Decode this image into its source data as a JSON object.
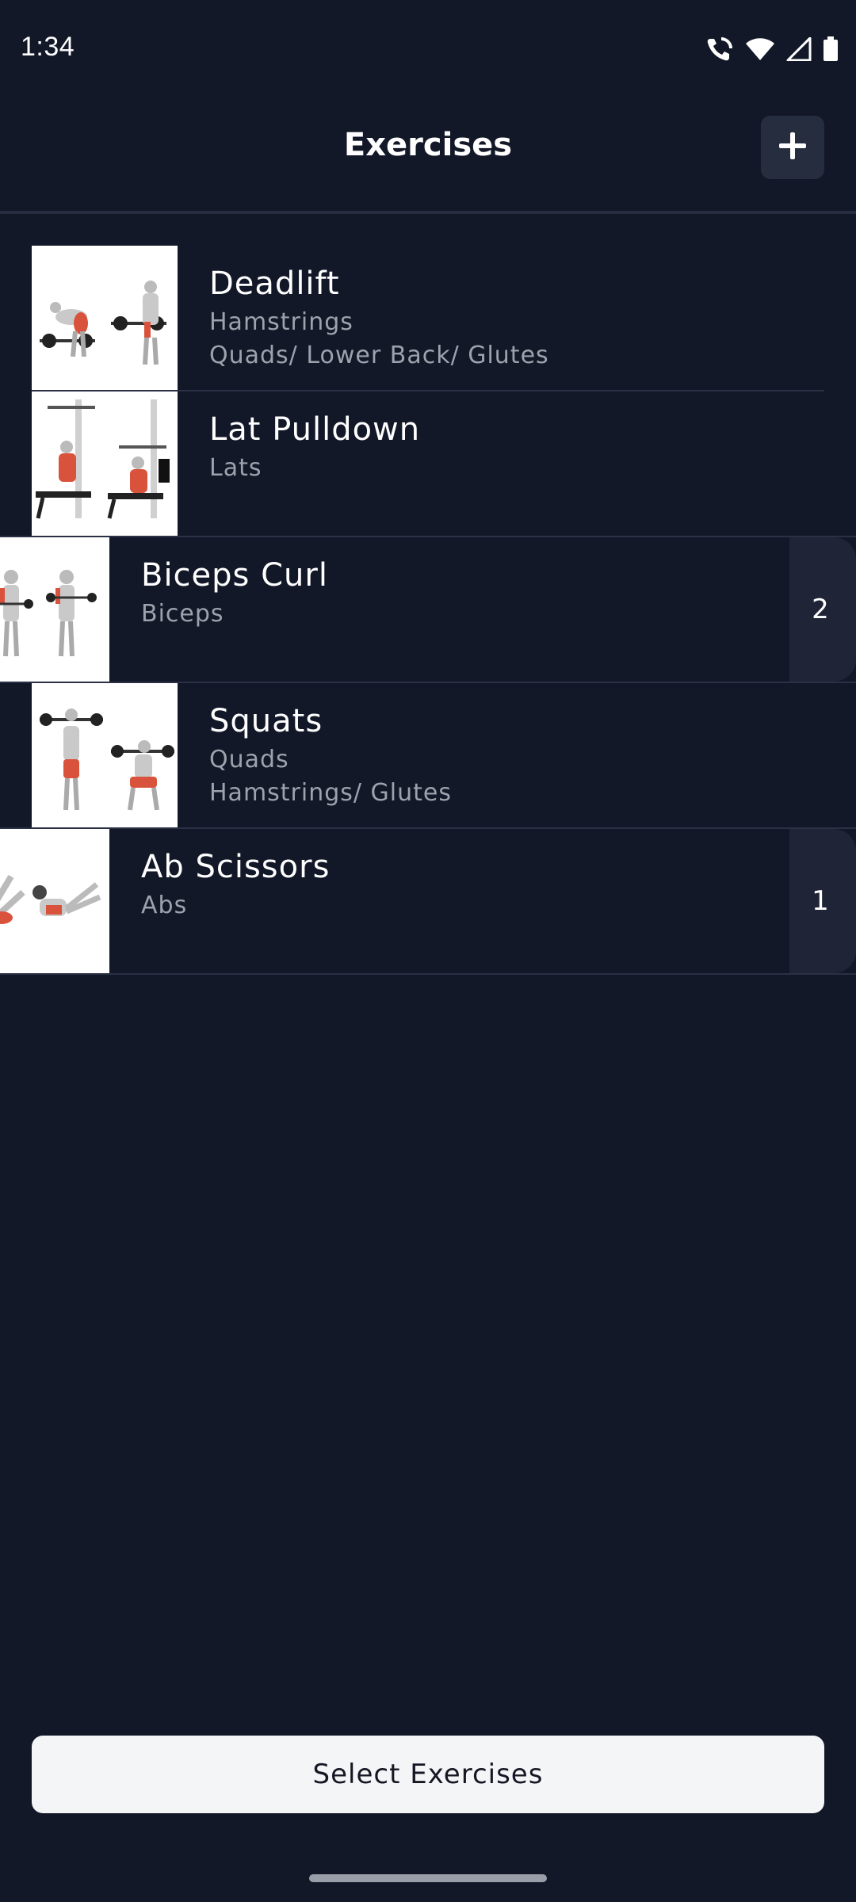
{
  "status_bar": {
    "time": "1:34",
    "icons": [
      "wifi-calling-icon",
      "wifi-icon",
      "signal-icon",
      "battery-icon"
    ]
  },
  "header": {
    "title": "Exercises",
    "add_icon": "plus-icon"
  },
  "exercises": [
    {
      "name": "Deadlift",
      "primary": "Hamstrings",
      "secondary": "Quads/ Lower Back/ Glutes",
      "swiped": false,
      "action_label": ""
    },
    {
      "name": "Lat Pulldown",
      "primary": "Lats",
      "secondary": "",
      "swiped": false,
      "action_label": ""
    },
    {
      "name": "Biceps Curl",
      "primary": "Biceps",
      "secondary": "",
      "swiped": true,
      "action_label": "2"
    },
    {
      "name": "Squats",
      "primary": "Quads",
      "secondary": "Hamstrings/ Glutes",
      "swiped": false,
      "action_label": ""
    },
    {
      "name": "Ab Scissors",
      "primary": "Abs",
      "secondary": "",
      "swiped": true,
      "action_label": "1"
    }
  ],
  "footer": {
    "select_label": "Select Exercises"
  },
  "colors": {
    "background": "#131829",
    "header_button": "#262d3e",
    "muscle_text": "#9da2ad",
    "primary_button": "#f4f5f7",
    "highlight_muscle": "#d9523c"
  }
}
